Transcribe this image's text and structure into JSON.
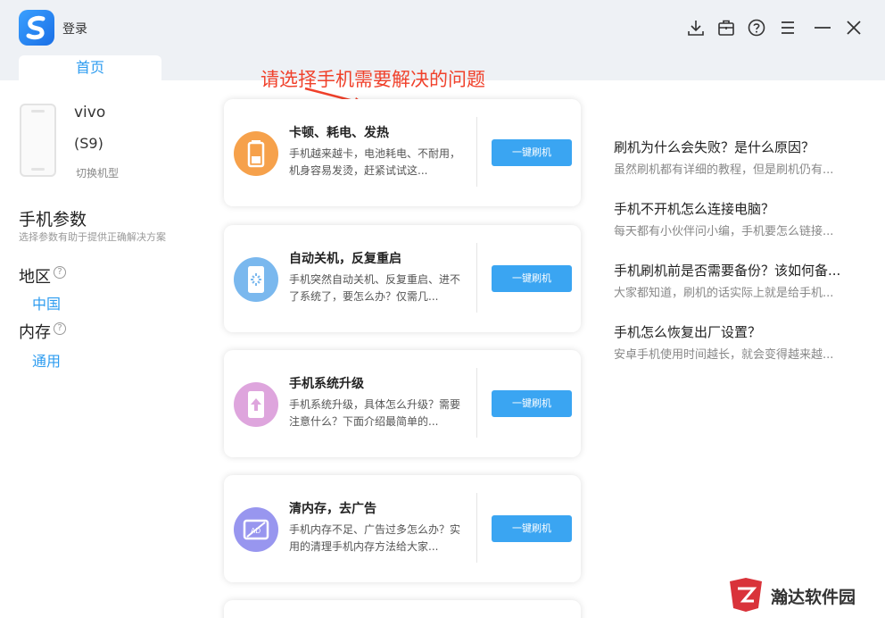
{
  "titlebar": {
    "login": "登录",
    "icons": [
      "download-icon",
      "toolbox-icon",
      "help-icon",
      "menu-icon",
      "minimize-icon",
      "close-icon"
    ]
  },
  "tabs": {
    "home": "首页"
  },
  "device": {
    "brand": "vivo",
    "model": "(S9)",
    "switch": "切换机型"
  },
  "params": {
    "title": "手机参数",
    "subtitle": "选择参数有助于提供正确解决方案",
    "region_label": "地区",
    "region_value": "中国",
    "memory_label": "内存",
    "memory_value": "通用",
    "help_glyph": "?"
  },
  "annotation": "请选择手机需要解决的问题",
  "cards": [
    {
      "title": "卡顿、耗电、发热",
      "desc": "手机越来越卡，电池耗电、不耐用，机身容易发烫，赶紧试试这...",
      "button": "一键刷机",
      "icon": "battery-icon",
      "color": "#f6a14b"
    },
    {
      "title": "自动关机，反复重启",
      "desc": "手机突然自动关机、反复重启、进不了系统了，要怎么办？仅需几...",
      "button": "一键刷机",
      "icon": "phone-loading-icon",
      "color": "#7ab8ee"
    },
    {
      "title": "手机系统升级",
      "desc": "手机系统升级，具体怎么升级？需要注意什么？下面介绍最简单的...",
      "button": "一键刷机",
      "icon": "phone-upgrade-icon",
      "color": "#dea5dd"
    },
    {
      "title": "清内存，去广告",
      "desc": "手机内存不足、广告过多怎么办？实用的清理手机内存方法给大家...",
      "button": "一键刷机",
      "icon": "no-ad-icon",
      "color": "#9896ef"
    }
  ],
  "articles": [
    {
      "title": "刷机为什么会失败？是什么原因？",
      "summary": "虽然刷机都有详细的教程，但是刷机仍有..."
    },
    {
      "title": "手机不开机怎么连接电脑？",
      "summary": "每天都有小伙伴问小编，手机要怎么链接..."
    },
    {
      "title": "手机刷机前是否需要备份？该如何备...",
      "summary": "大家都知道，刷机的话实际上就是给手机..."
    },
    {
      "title": "手机怎么恢复出厂设置？",
      "summary": "安卓手机使用时间越长，就会变得越来越..."
    }
  ],
  "watermark": "瀚达软件园",
  "colors": {
    "accent": "#2d9cf0",
    "button": "#3aa5f2",
    "annotation": "#f0412b"
  }
}
